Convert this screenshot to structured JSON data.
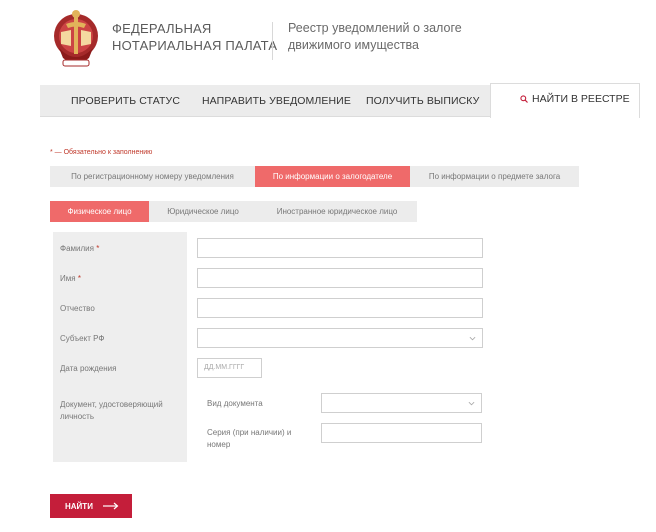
{
  "header": {
    "org_line1": "ФЕДЕРАЛЬНАЯ",
    "org_line2": "НОТАРИАЛЬНАЯ ПАЛАТА",
    "registry_line1": "Реестр уведомлений о залоге",
    "registry_line2": "движимого имущества",
    "logo_icon": "notary-emblem-icon"
  },
  "nav": {
    "items": [
      "ПРОВЕРИТЬ СТАТУС",
      "НАПРАВИТЬ УВЕДОМЛЕНИЕ",
      "ПОЛУЧИТЬ ВЫПИСКУ"
    ],
    "active_label": "НАЙТИ В РЕЕСТРЕ",
    "active_icon": "search-icon"
  },
  "form": {
    "required_note": "* — Обязательно к заполнению",
    "search_tabs": [
      {
        "label": "По регистрационному номеру уведомления",
        "active": false
      },
      {
        "label": "По информации о залогодателе",
        "active": true
      },
      {
        "label": "По информации о предмете залога",
        "active": false
      }
    ],
    "person_tabs": [
      {
        "label": "Физическое лицо",
        "active": true
      },
      {
        "label": "Юридическое лицо",
        "active": false
      },
      {
        "label": "Иностранное юридическое лицо",
        "active": false
      }
    ],
    "fields": {
      "surname_label": "Фамилия",
      "name_label": "Имя",
      "patronymic_label": "Отчество",
      "region_label": "Субъект РФ",
      "birthdate_label": "Дата рождения",
      "birthdate_placeholder": "ДД.ММ.ГГГГ",
      "document_label_line1": "Документ, удостоверяющий",
      "document_label_line2": "личность",
      "doc_type_label": "Вид документа",
      "doc_series_line1": "Серия (при наличии) и",
      "doc_series_line2": "номер",
      "required_mark": "*"
    },
    "submit_label": "НАЙТИ",
    "submit_icon": "arrow-right-icon"
  },
  "colors": {
    "brand_red": "#c41e3a",
    "tab_active": "#ef6a6a",
    "tab_inactive": "#ececec"
  }
}
